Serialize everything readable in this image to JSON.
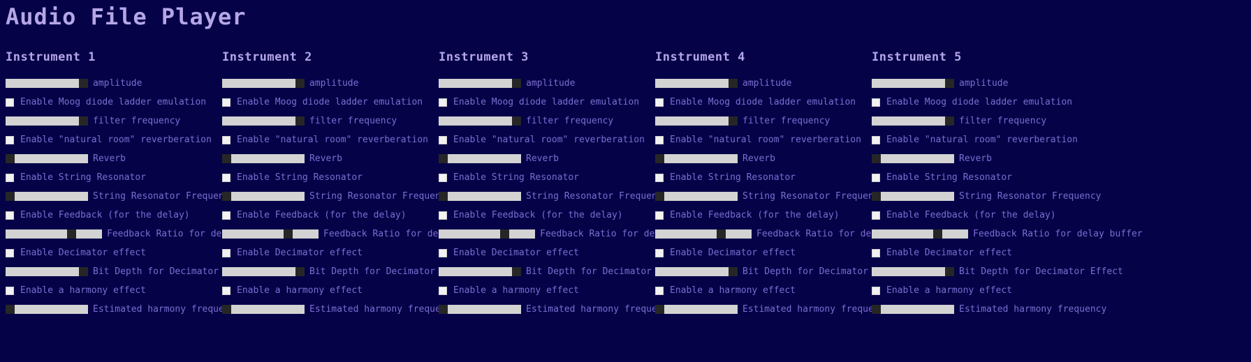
{
  "app": {
    "title": "Audio File Player",
    "background_color": "#050248",
    "title_color": "#b5a6e6",
    "label_color": "#7b6fd0",
    "slider_track_color": "#d3d3d3",
    "slider_thumb_color": "#262626",
    "checkbox_color": "#f2f2f2"
  },
  "controls": [
    {
      "type": "slider",
      "label": "amplitude",
      "value": 100,
      "track_width": 118
    },
    {
      "type": "checkbox",
      "label": "Enable Moog diode ladder emulation",
      "checked": false
    },
    {
      "type": "slider",
      "label": "filter frequency",
      "value": 100,
      "track_width": 118
    },
    {
      "type": "checkbox",
      "label": "Enable \"natural room\" reverberation",
      "checked": false
    },
    {
      "type": "slider",
      "label": "Reverb",
      "value": 0,
      "track_width": 118
    },
    {
      "type": "checkbox",
      "label": "Enable String Resonator",
      "checked": false
    },
    {
      "type": "slider",
      "label": "String Resonator Frequency",
      "value": 0,
      "track_width": 118
    },
    {
      "type": "checkbox",
      "label": "Enable Feedback (for the delay)",
      "checked": false
    },
    {
      "type": "slider",
      "label": "Feedback Ratio for delay buffer",
      "value": 70,
      "track_width": 138
    },
    {
      "type": "checkbox",
      "label": "Enable Decimator effect",
      "checked": false
    },
    {
      "type": "slider",
      "label": "Bit Depth for Decimator Effect",
      "value": 100,
      "track_width": 118
    },
    {
      "type": "checkbox",
      "label": "Enable a harmony effect",
      "checked": false
    },
    {
      "type": "slider",
      "label": "Estimated harmony frequency",
      "value": 0,
      "track_width": 118
    }
  ],
  "instruments": [
    {
      "title": "Instrument 1"
    },
    {
      "title": "Instrument 2"
    },
    {
      "title": "Instrument 3"
    },
    {
      "title": "Instrument 4"
    },
    {
      "title": "Instrument 5"
    }
  ]
}
